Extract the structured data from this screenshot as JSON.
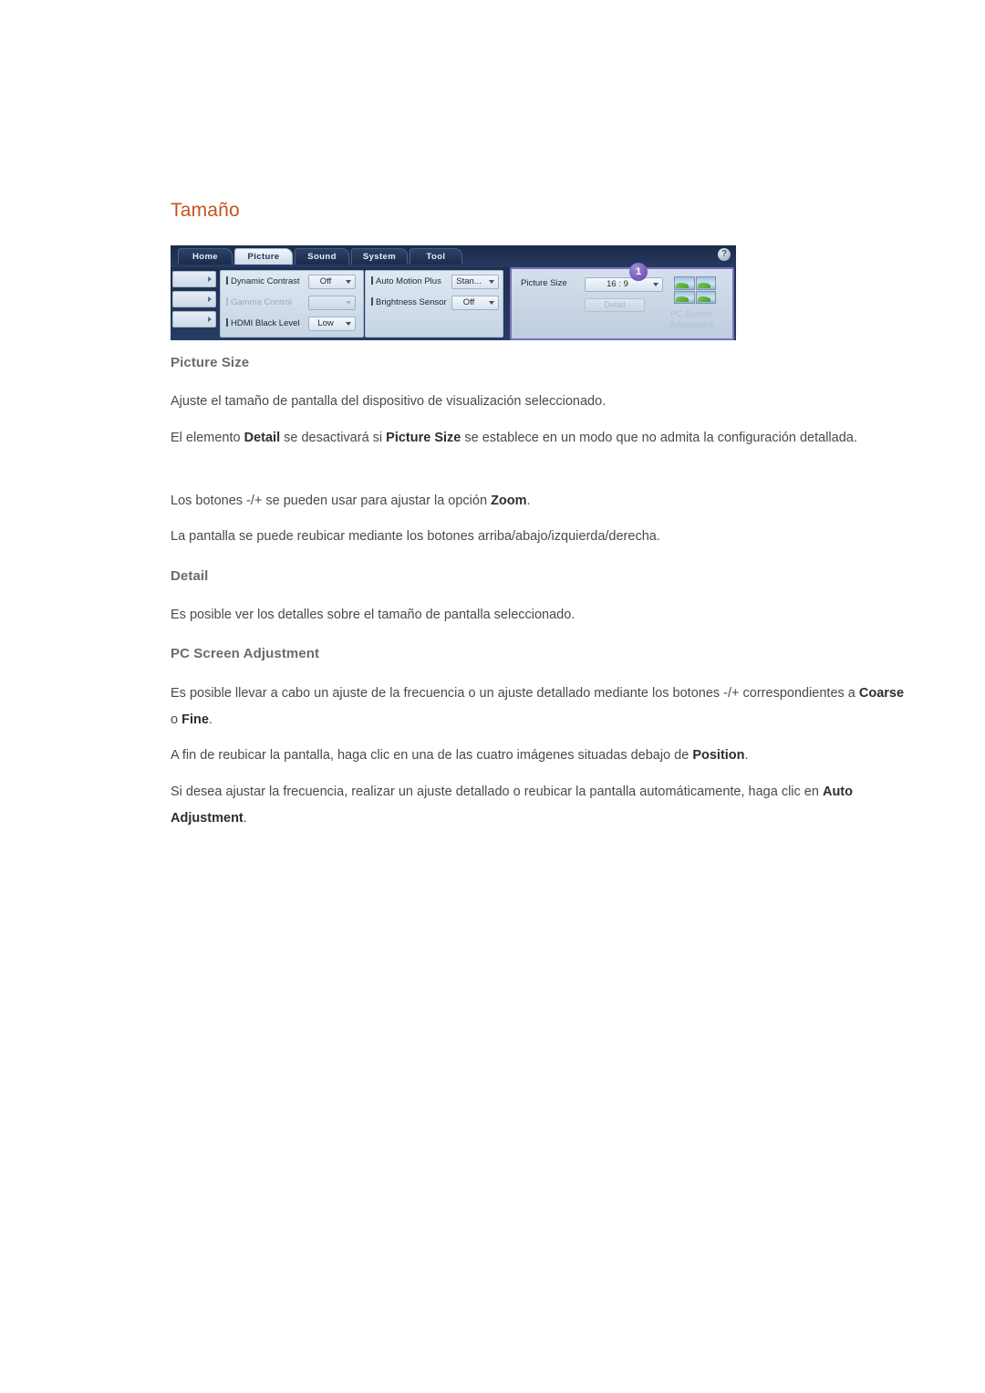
{
  "document": {
    "heading": "Tamaño",
    "sections": [
      {
        "title": "Picture Size",
        "paragraphs": [
          {
            "id": "p1",
            "parts": [
              {
                "t": "Ajuste el tamaño de pantalla del dispositivo de visualización seleccionado.",
                "b": false
              }
            ]
          },
          {
            "id": "p2",
            "parts": [
              {
                "t": "El elemento ",
                "b": false
              },
              {
                "t": "Detail",
                "b": true
              },
              {
                "t": " se desactivará si ",
                "b": false
              },
              {
                "t": "Picture Size",
                "b": true
              },
              {
                "t": " se establece en un modo que no admita la configuración detallada.",
                "b": false
              }
            ]
          },
          {
            "id": "p3",
            "parts": [
              {
                "t": "Los botones -/+ se pueden usar para ajustar la opción ",
                "b": false
              },
              {
                "t": "Zoom",
                "b": true
              },
              {
                "t": ".",
                "b": false
              }
            ]
          },
          {
            "id": "p4",
            "parts": [
              {
                "t": "La pantalla se puede reubicar mediante los botones arriba/abajo/izquierda/derecha.",
                "b": false
              }
            ]
          }
        ]
      },
      {
        "title": "Detail",
        "paragraphs": [
          {
            "id": "p5",
            "parts": [
              {
                "t": "Es posible ver los detalles sobre el tamaño de pantalla seleccionado.",
                "b": false
              }
            ]
          }
        ]
      },
      {
        "title": "PC Screen Adjustment",
        "paragraphs": [
          {
            "id": "p6",
            "parts": [
              {
                "t": "Es posible llevar a cabo un ajuste de la frecuencia o un ajuste detallado mediante los botones -/+ correspondientes a ",
                "b": false
              },
              {
                "t": "Coarse",
                "b": true
              },
              {
                "t": " o ",
                "b": false
              },
              {
                "t": "Fine",
                "b": true
              },
              {
                "t": ".",
                "b": false
              }
            ]
          },
          {
            "id": "p7",
            "parts": [
              {
                "t": "A fin de reubicar la pantalla, haga clic en una de las cuatro imágenes situadas debajo de ",
                "b": false
              },
              {
                "t": "Position",
                "b": true
              },
              {
                "t": ".",
                "b": false
              }
            ]
          },
          {
            "id": "p8",
            "parts": [
              {
                "t": "Si desea ajustar la frecuencia, realizar un ajuste detallado o reubicar la pantalla automáticamente, haga clic en ",
                "b": false
              },
              {
                "t": "Auto Adjustment",
                "b": true
              },
              {
                "t": ".",
                "b": false
              }
            ]
          }
        ]
      }
    ]
  },
  "osd": {
    "tabs": [
      {
        "label": "Home",
        "selected": false
      },
      {
        "label": "Picture",
        "selected": true
      },
      {
        "label": "Sound",
        "selected": false
      },
      {
        "label": "System",
        "selected": false
      },
      {
        "label": "Tool",
        "selected": false
      }
    ],
    "help_icon_label": "?",
    "badge_label": "1",
    "left_strip_arrow": "chevron-right-icon",
    "column_a": [
      {
        "label": "Dynamic Contrast",
        "value": "Off",
        "disabled": false
      },
      {
        "label": "Gamma Control",
        "value": "",
        "disabled": true
      },
      {
        "label": "HDMI Black Level",
        "value": "Low",
        "disabled": false
      }
    ],
    "column_b": [
      {
        "label": "Auto Motion Plus",
        "value": "Stan...",
        "disabled": false
      },
      {
        "label": "Brightness Sensor",
        "value": "Off",
        "disabled": false
      }
    ],
    "right_panel": {
      "picture_size_label": "Picture Size",
      "picture_size_value": "16 : 9",
      "detail_button_label": "Detail",
      "detail_button_disabled": true,
      "pc_screen_adjustment_label": "PC Screen Adjustment",
      "thumbnail_count": 4
    }
  },
  "colors": {
    "heading": "#c4531f",
    "section_title": "#6b6b6b",
    "body_text": "#4a4a4a",
    "badge": "#7b63bd",
    "panel_highlight_border": "#7d6fba",
    "osd_background": "#24395d"
  }
}
